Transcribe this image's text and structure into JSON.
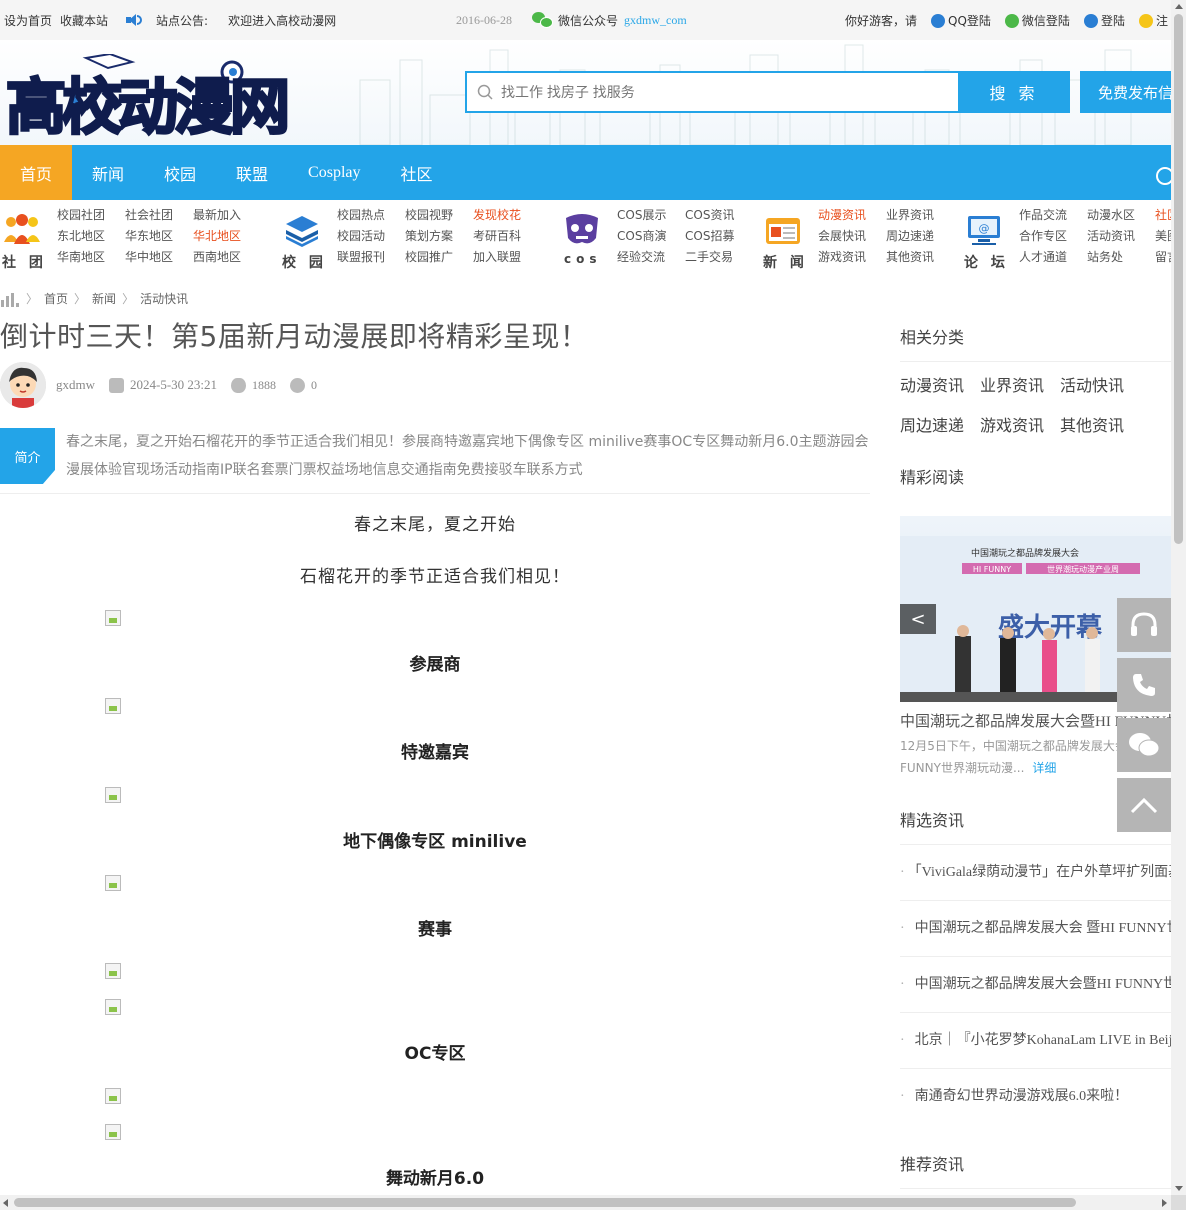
{
  "topbar": {
    "set_home": "设为首页",
    "bookmark": "收藏本站",
    "notice_label": "站点公告:",
    "notice_text": "欢迎进入高校动漫网",
    "notice_date": "2016-06-28",
    "wechat_label": "微信公众号",
    "wechat_account": "gxdmw_com",
    "greeting": "你好游客，请",
    "qq_login": "QQ登陆",
    "wechat_login": "微信登陆",
    "login": "登陆",
    "register_partial": "注"
  },
  "header": {
    "logo_text": "高校动漫网",
    "search_placeholder": "找工作 找房子 找服务",
    "search_button": "搜 索",
    "publish_button": "免费发布信息"
  },
  "nav": {
    "items": [
      "首页",
      "新闻",
      "校园",
      "联盟",
      "Cosplay",
      "社区"
    ]
  },
  "categories": [
    {
      "label": "社 团",
      "cols": [
        [
          "校园社团",
          "东北地区",
          "华南地区"
        ],
        [
          "社会社团",
          "华东地区",
          "华中地区"
        ],
        [
          "最新加入",
          "华北地区",
          "西南地区"
        ]
      ],
      "highlight": [
        "华北地区"
      ]
    },
    {
      "label": "校 园",
      "cols": [
        [
          "校园热点",
          "校园活动",
          "联盟报刊"
        ],
        [
          "校园视野",
          "策划方案",
          "校园推广"
        ],
        [
          "发现校花",
          "考研百科",
          "加入联盟"
        ]
      ],
      "highlight": [
        "发现校花"
      ]
    },
    {
      "label": "cos",
      "cols": [
        [
          "COS展示",
          "COS商演",
          "经验交流"
        ],
        [
          "COS资讯",
          "COS招募",
          "二手交易"
        ]
      ],
      "highlight": []
    },
    {
      "label": "新 闻",
      "cols": [
        [
          "动漫资讯",
          "会展快讯",
          "游戏资讯"
        ],
        [
          "业界资讯",
          "周边速递",
          "其他资讯"
        ]
      ],
      "highlight": [
        "动漫资讯"
      ]
    },
    {
      "label": "论 坛",
      "cols": [
        [
          "作品交流",
          "合作专区",
          "人才通道"
        ],
        [
          "动漫水区",
          "活动资讯",
          "站务处"
        ],
        [
          "社区",
          "美图",
          "留言"
        ]
      ],
      "highlight": [
        "社区"
      ]
    }
  ],
  "breadcrumb": [
    "首页",
    "新闻",
    "活动快讯"
  ],
  "article": {
    "title": "倒计时三天！第5届新月动漫展即将精彩呈现！",
    "author": "gxdmw",
    "datetime": "2024-5-30 23:21",
    "views": "1888",
    "comments": "0",
    "intro_tag": "简介",
    "intro": "春之末尾，夏之开始石榴花开的季节正适合我们相见！参展商特邀嘉宾地下偶像专区 minilive赛事OC专区舞动新月6.0主题游园会漫展体验官现场活动指南IP联名套票门票权益场地信息交通指南免费接驳车联系方式",
    "paragraphs": [
      "春之末尾，夏之开始",
      "石榴花开的季节正适合我们相见！"
    ],
    "sections": [
      "参展商",
      "特邀嘉宾",
      "地下偶像专区 minilive",
      "赛事",
      "OC专区",
      "舞动新月6.0"
    ]
  },
  "sidebar": {
    "related_title": "相关分类",
    "related": [
      "动漫资讯",
      "业界资讯",
      "活动快讯",
      "周边速递",
      "游戏资讯",
      "其他资讯"
    ],
    "featured_title": "精彩阅读",
    "slide_banner_line1": "中国潮玩之都品牌发展大会",
    "slide_banner_tag1": "HI FUNNY",
    "slide_banner_tag2": "世界潮玩动漫产业周",
    "slide_banner_big": "盛大开幕",
    "slide_title": "中国潮玩之都品牌发展大会暨HI FUNNY世界潮玩动漫产业周",
    "slide_desc": "12月5日下午，中国潮玩之都品牌发展大会暨HI FUNNY世界潮玩动漫...",
    "slide_more": "详细",
    "selected_title": "精选资讯",
    "selected": [
      "「ViviGala绿荫动漫节」在户外草坪扩列面基",
      "中国潮玩之都品牌发展大会 暨HI FUNNY世界潮玩动漫产业周",
      "中国潮玩之都品牌发展大会暨HI FUNNY世界潮玩动漫产业周",
      "北京｜『小花罗梦KohanaLam LIVE in Beijing』",
      "南通奇幻世界动漫游戏展6.0来啦！"
    ],
    "recommended_title": "推荐资讯"
  },
  "colors": {
    "accent": "#23a4e8",
    "active_nav": "#f5a623",
    "highlight": "#e8501f"
  }
}
